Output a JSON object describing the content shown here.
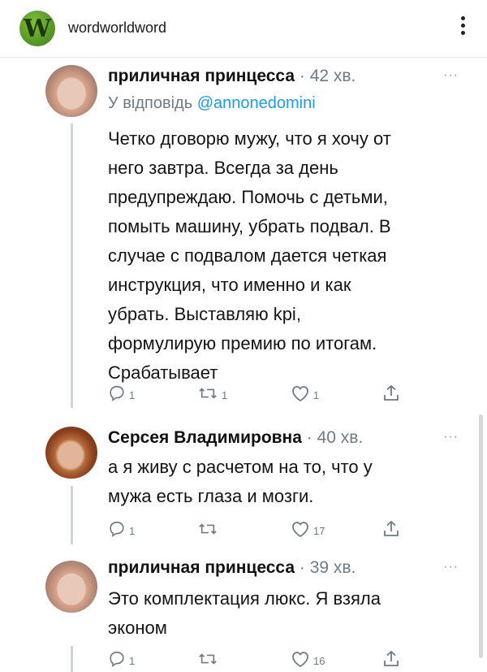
{
  "header": {
    "logo_letter": "W",
    "account_name": "wordworldword",
    "menu_icon": "kebab-menu-icon"
  },
  "tweets": [
    {
      "author": "приличная принцесса",
      "time": "· 42 хв.",
      "reply_prefix": "У відповідь",
      "reply_handle": "@annonedomini",
      "lines": [
        "Четко дговорю мужу, что я хочу от",
        "него завтра. Всегда за день",
        "предупреждаю. Помочь с детьми,",
        "помыть машину, убрать подвал. В",
        "случае с подвалом дается четкая",
        "инструкция, что именно и как",
        "убрать.  Выставляю kpi,",
        "формулирую премию по итогам.",
        "Срабатывает"
      ],
      "reply_count": "1",
      "retweet_count": "1",
      "like_count": "1"
    },
    {
      "author": "Серсея Владимировна",
      "time": "· 40 хв.",
      "lines": [
        "а я живу с расчетом на то, что у",
        "мужа есть глаза и мозги."
      ],
      "reply_count": "1",
      "retweet_count": "",
      "like_count": "17"
    },
    {
      "author": "приличная принцесса",
      "time": "· 39 хв.",
      "lines": [
        "Это комплектация люкс. Я взяла",
        "эконом"
      ],
      "reply_count": "1",
      "retweet_count": "",
      "like_count": "16"
    }
  ],
  "more_label": "···",
  "colors": {
    "link": "#1d9bf0",
    "muted": "#6e7a85",
    "thread_line": "#cfd5da",
    "logo_green": "#5a9e2a"
  },
  "icons": [
    "reply-icon",
    "retweet-icon",
    "like-icon",
    "share-icon"
  ]
}
